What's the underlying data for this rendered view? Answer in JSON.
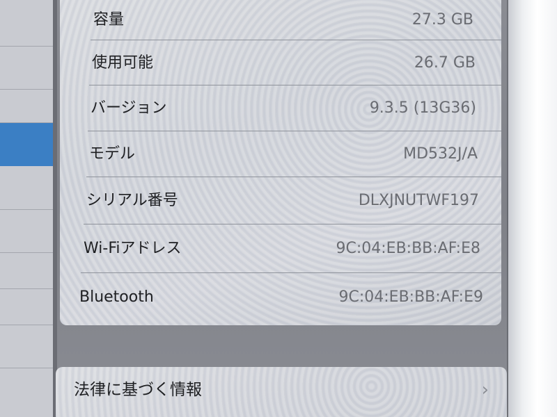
{
  "about": {
    "rows": [
      {
        "label": "容量",
        "value": "27.3 GB"
      },
      {
        "label": "使用可能",
        "value": "26.7 GB"
      },
      {
        "label": "バージョン",
        "value": "9.3.5 (13G36)"
      },
      {
        "label": "モデル",
        "value": "MD532J/A"
      },
      {
        "label": "シリアル番号",
        "value": "DLXJNUTWF197"
      },
      {
        "label": "Wi-Fiアドレス",
        "value": "9C:04:EB:BB:AF:E8"
      },
      {
        "label": "Bluetooth",
        "value": "9C:04:EB:BB:AF:E9"
      }
    ]
  },
  "legal": {
    "label": "法律に基づく情報",
    "chevron": "›",
    "icon": "chevron-right-icon"
  },
  "colors": {
    "selected_row": "#3b7fc4",
    "label_text": "#1e1f22",
    "value_text": "#6a6c72"
  }
}
